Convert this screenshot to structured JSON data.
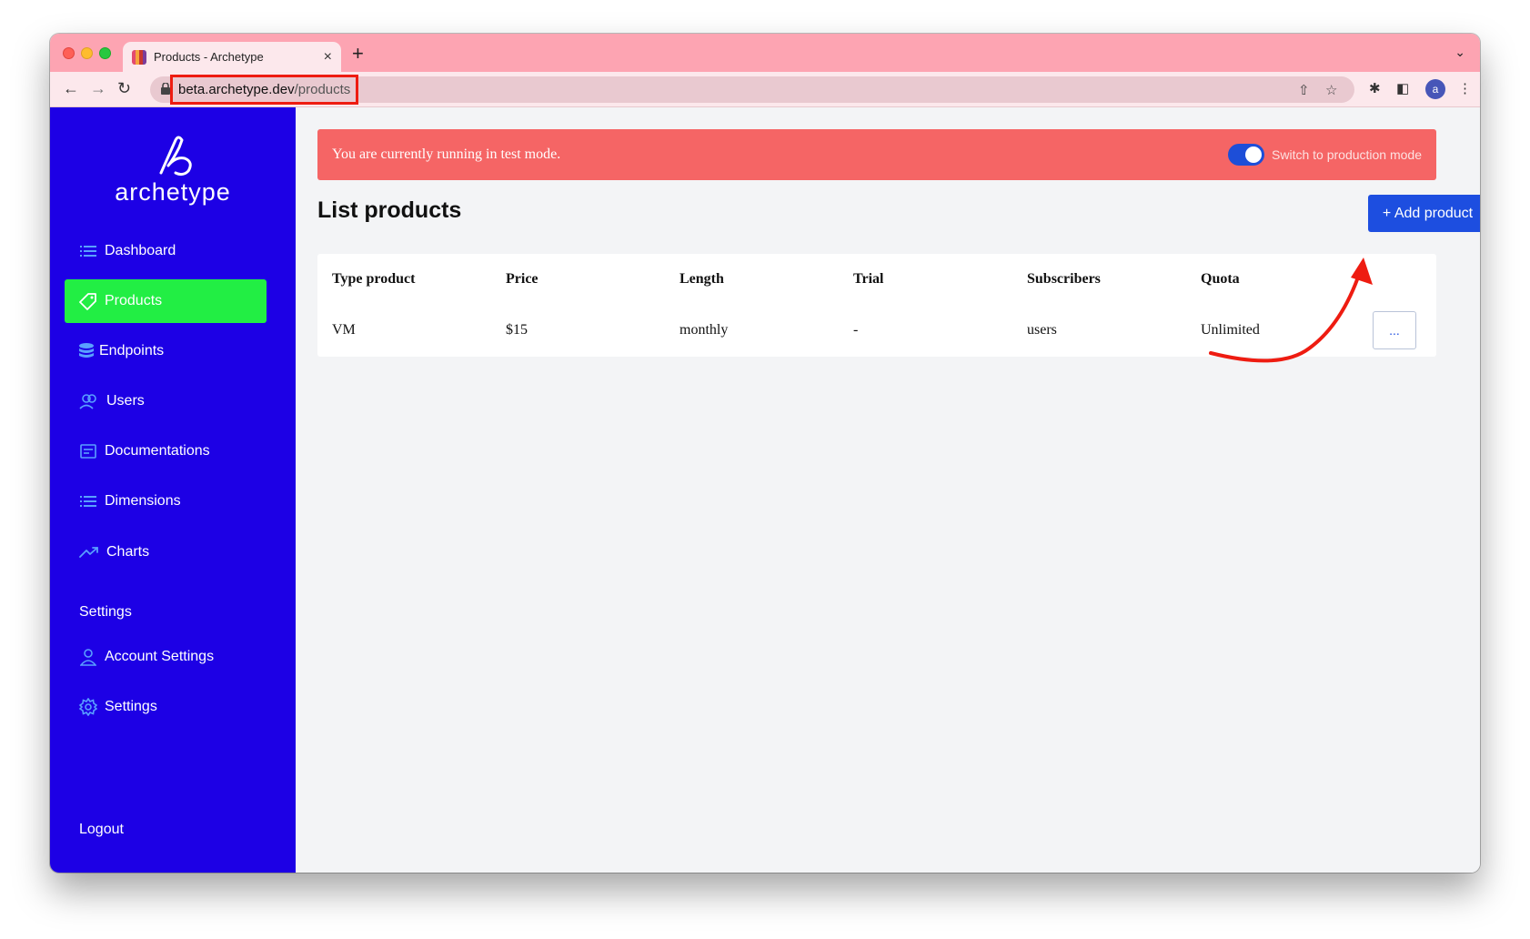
{
  "browser": {
    "tab_title": "Products - Archetype",
    "new_tab_symbol": "+",
    "close_symbol": "×",
    "url_host": "beta.archetype.dev",
    "url_path": "/products"
  },
  "sidebar": {
    "logo_text": "archetype",
    "items": [
      {
        "label": "Dashboard",
        "icon": "list-icon"
      },
      {
        "label": "Products",
        "icon": "tag-icon",
        "active": true
      },
      {
        "label": "Endpoints",
        "icon": "database-icon"
      },
      {
        "label": "Users",
        "icon": "users-icon"
      },
      {
        "label": "Documentations",
        "icon": "document-icon"
      },
      {
        "label": "Dimensions",
        "icon": "list-icon"
      },
      {
        "label": "Charts",
        "icon": "trending-up-icon"
      }
    ],
    "settings_section": "Settings",
    "settings_items": [
      {
        "label": "Account Settings",
        "icon": "user-icon"
      },
      {
        "label": "Settings",
        "icon": "gear-icon"
      }
    ],
    "logout": "Logout"
  },
  "banner": {
    "text": "You are currently running in test mode.",
    "toggle_label": "Switch to production mode"
  },
  "page": {
    "title": "List products",
    "add_button": "+ Add product"
  },
  "table": {
    "headers": [
      "Type product",
      "Price",
      "Length",
      "Trial",
      "Subscribers",
      "Quota"
    ],
    "rows": [
      [
        "VM",
        "$15",
        "monthly",
        "-",
        "users",
        "Unlimited"
      ]
    ],
    "row_action": "..."
  },
  "colors": {
    "sidebar_bg": "#1d00e5",
    "active_item": "#22ee44",
    "banner_bg": "#f56565",
    "primary_button": "#1d4ee0",
    "annotation": "#ee1c11"
  }
}
